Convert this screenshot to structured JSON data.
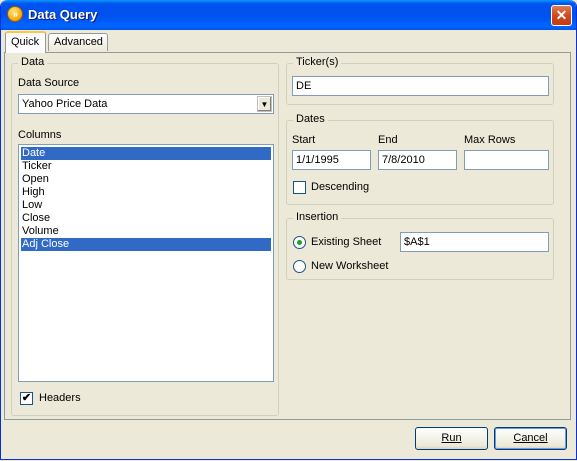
{
  "window": {
    "title": "Data Query",
    "icon": "app-logo-icon",
    "close_icon": "close-icon"
  },
  "tabs": [
    {
      "label": "Quick",
      "active": true
    },
    {
      "label": "Advanced",
      "active": false
    }
  ],
  "data_group": {
    "legend": "Data",
    "data_source_label": "Data Source",
    "data_source_value": "Yahoo Price Data",
    "columns_label": "Columns",
    "columns": [
      {
        "label": "Date",
        "selected": true
      },
      {
        "label": "Ticker",
        "selected": false
      },
      {
        "label": "Open",
        "selected": false
      },
      {
        "label": "High",
        "selected": false
      },
      {
        "label": "Low",
        "selected": false
      },
      {
        "label": "Close",
        "selected": false
      },
      {
        "label": "Volume",
        "selected": false
      },
      {
        "label": "Adj Close",
        "selected": true
      }
    ],
    "headers_label": "Headers",
    "headers_checked": true,
    "check_mark": "✔"
  },
  "tickers_group": {
    "legend": "Ticker(s)",
    "value": "DE"
  },
  "dates_group": {
    "legend": "Dates",
    "start_label": "Start",
    "start_value": "1/1/1995",
    "end_label": "End",
    "end_value": "7/8/2010",
    "max_rows_label": "Max Rows",
    "max_rows_value": "",
    "descending_label": "Descending",
    "descending_checked": false
  },
  "insertion_group": {
    "legend": "Insertion",
    "existing_sheet_label": "Existing Sheet",
    "existing_sheet_selected": true,
    "existing_sheet_value": "$A$1",
    "new_worksheet_label": "New Worksheet",
    "new_worksheet_selected": false
  },
  "buttons": {
    "run_label": "Run",
    "cancel_label": "Cancel"
  },
  "colors": {
    "title_bar": "#0053ee",
    "selection": "#316ac5",
    "close_button": "#d0451a"
  }
}
